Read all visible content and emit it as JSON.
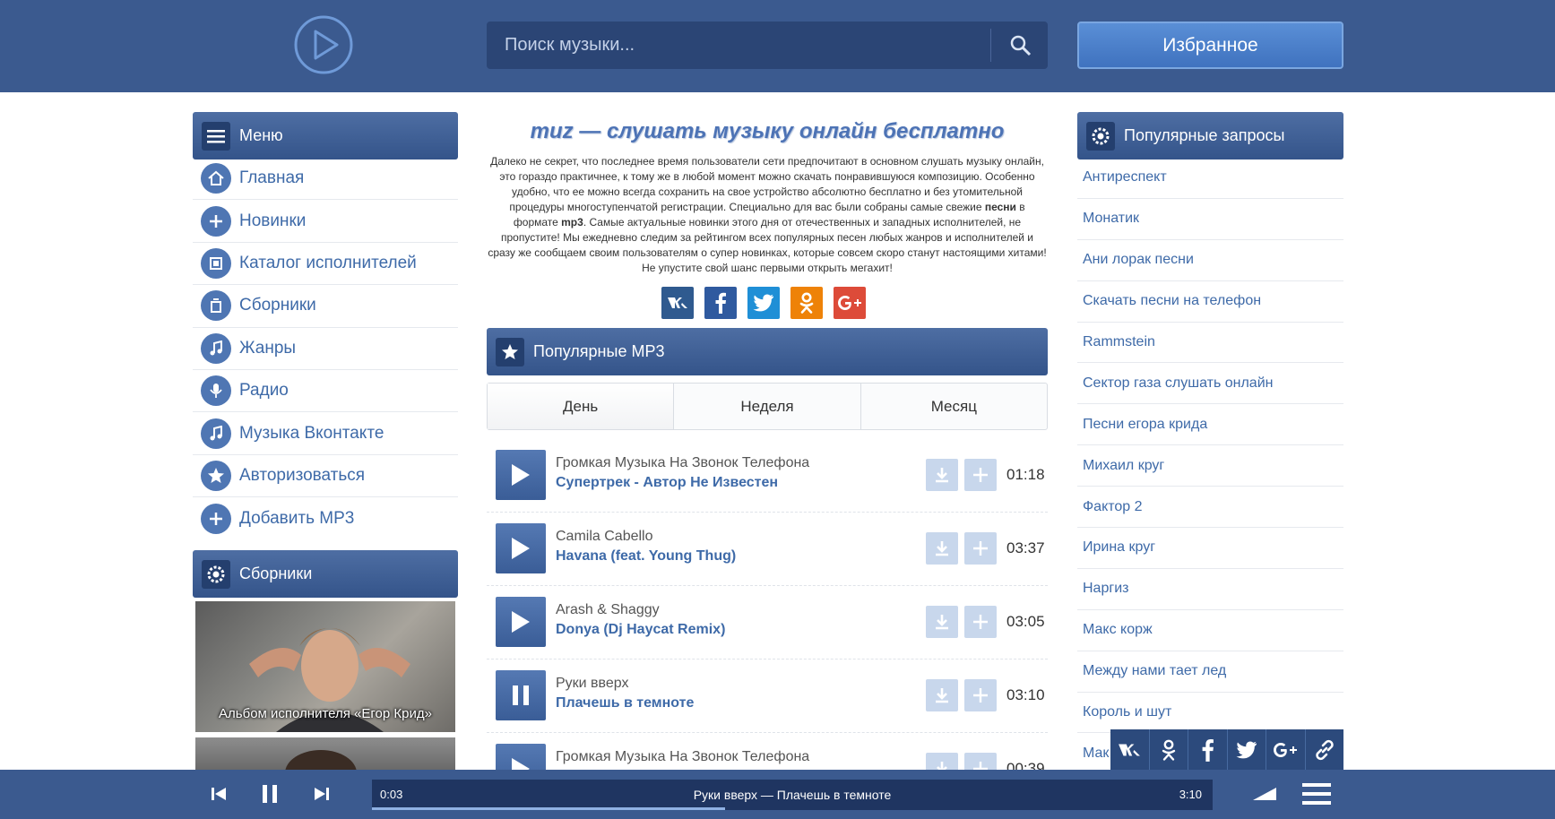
{
  "header": {
    "search_placeholder": "Поиск музыки...",
    "favorites_label": "Избранное"
  },
  "colors": {
    "brand": "#3b5a8f",
    "link": "#3e6aa8",
    "accent": "#4f76b3"
  },
  "menu": {
    "title": "Меню",
    "items": [
      {
        "label": "Главная",
        "icon": "home-icon"
      },
      {
        "label": "Новинки",
        "icon": "plus-icon"
      },
      {
        "label": "Каталог исполнителей",
        "icon": "catalog-icon"
      },
      {
        "label": "Сборники",
        "icon": "collection-icon"
      },
      {
        "label": "Жанры",
        "icon": "music-note-icon"
      },
      {
        "label": "Радио",
        "icon": "microphone-icon"
      },
      {
        "label": "Музыка Вконтакте",
        "icon": "music-note-icon"
      },
      {
        "label": "Авторизоваться",
        "icon": "star-icon"
      },
      {
        "label": "Добавить MP3",
        "icon": "plus-icon"
      }
    ]
  },
  "collections": {
    "title": "Сборники",
    "items": [
      {
        "caption": "Альбом исполнителя «Егор Крид»"
      }
    ]
  },
  "main": {
    "title": "muz — слушать музыку онлайн бесплатно",
    "intro_part1": "Далеко не секрет, что последнее время пользователи сети предпочитают в основном слушать музыку онлайн, это гораздо практичнее, к тому же в любой момент можно скачать понравившуюся композицию. Особенно удобно, что ее можно всегда сохранить на свое устройство абсолютно бесплатно и без утомительной процедуры многоступенчатой регистрации. Специально для вас были собраны самые свежие ",
    "intro_bold1": "песни",
    "intro_part2": " в формате ",
    "intro_bold2": "mp3",
    "intro_part3": ". Самые актуальные новинки этого дня от отечественных и западных исполнителей, не пропустите! Мы ежедневно следим за рейтингом всех популярных песен любых жанров и исполнителей и сразу же сообщаем своим пользователям о супер новинках, которые совсем скоро станут настоящими хитами! Не упустите свой шанс первыми открыть мегахит!",
    "social": [
      {
        "glyph": "vk",
        "color": "#2f5a8f"
      },
      {
        "glyph": "f",
        "color": "#2f5a9f"
      },
      {
        "glyph": "t",
        "color": "#1f8fd6"
      },
      {
        "glyph": "ok",
        "color": "#ee8208"
      },
      {
        "glyph": "G+",
        "color": "#dd4b39"
      }
    ],
    "popular_title": "Популярные MP3",
    "tabs": [
      "День",
      "Неделя",
      "Месяц"
    ],
    "active_tab": "День",
    "tracks": [
      {
        "artist": "Громкая Музыка На Звонок Телефона",
        "title": "Супертрек - Автор Не Известен",
        "duration": "01:18",
        "state": "play"
      },
      {
        "artist": "Camila Cabello",
        "title": "Havana (feat. Young Thug)",
        "duration": "03:37",
        "state": "play"
      },
      {
        "artist": "Arash & Shaggy",
        "title": "Donya (Dj Haycat Remix)",
        "duration": "03:05",
        "state": "play"
      },
      {
        "artist": "Руки вверх",
        "title": "Плачешь в темноте",
        "duration": "03:10",
        "state": "pause"
      },
      {
        "artist": "Громкая Музыка На Звонок Телефона",
        "title": "",
        "duration": "00:39",
        "state": "play"
      }
    ]
  },
  "popular_requests": {
    "title": "Популярные запросы",
    "items": [
      "Антиреспект",
      "Монатик",
      "Ани лорак песни",
      "Скачать песни на телефон",
      "Rammstein",
      "Сектор газа слушать онлайн",
      "Песни егора крида",
      "Михаил круг",
      "Фактор 2",
      "Ирина круг",
      "Наргиз",
      "Макс корж",
      "Между нами тает лед",
      "Король и шут",
      "Мак"
    ]
  },
  "player": {
    "current_time": "0:03",
    "total_time": "3:10",
    "now_playing": "Руки вверх — Плачешь в темноте",
    "progress": 0.42
  }
}
